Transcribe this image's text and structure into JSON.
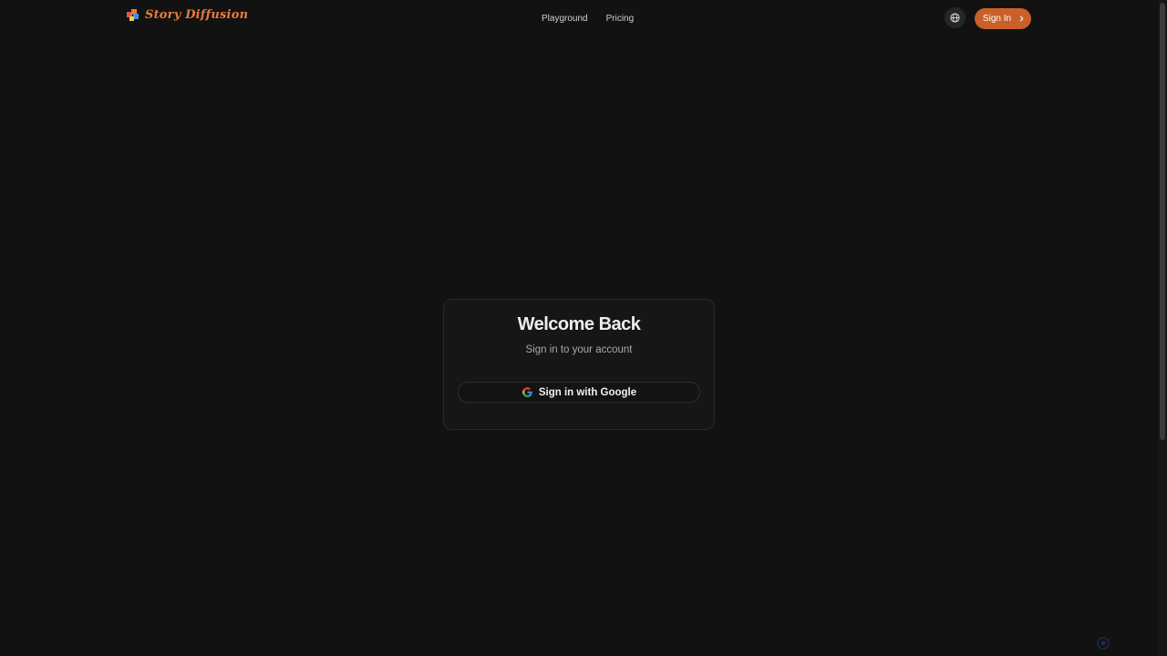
{
  "header": {
    "brand_name": "Story Diffusion",
    "nav": [
      {
        "label": "Playground"
      },
      {
        "label": "Pricing"
      }
    ],
    "language_icon": "globe-icon",
    "sign_in_label": "Sign In"
  },
  "card": {
    "title": "Welcome Back",
    "subtitle": "Sign in to your account",
    "google_button_label": "Sign in with Google"
  },
  "colors": {
    "background": "#121212",
    "accent": "#c9602a",
    "brand": "#e87b3e"
  }
}
